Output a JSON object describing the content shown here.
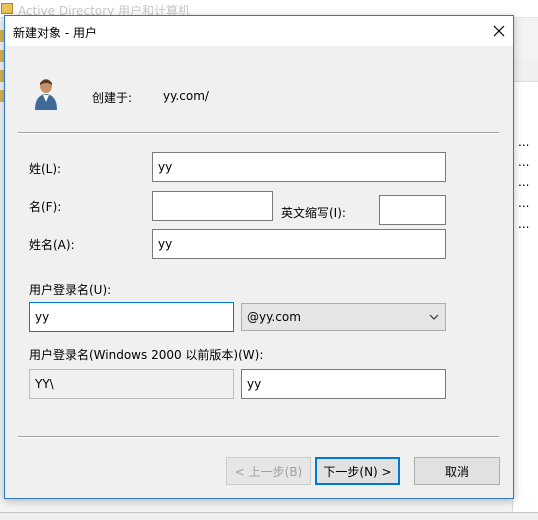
{
  "background_window": {
    "title": "Active Directory 用户和计算机",
    "list_ellipsis": [
      "...",
      "...",
      "...",
      "...",
      "..."
    ]
  },
  "dialog": {
    "title": "新建对象 - 用户",
    "created_in_label": "创建于:",
    "created_in_value": "yy.com/",
    "fields": {
      "last_name_label": "姓(L):",
      "last_name_value": "yy",
      "first_name_label": "名(F):",
      "first_name_value": "",
      "initials_label": "英文缩写(I):",
      "initials_value": "",
      "full_name_label": "姓名(A):",
      "full_name_value": "yy",
      "logon_name_label": "用户登录名(U):",
      "logon_name_value": "yy",
      "upn_suffix": "@yy.com",
      "pre2000_label": "用户登录名(Windows 2000 以前版本)(W):",
      "pre2000_domain": "YY\\",
      "pre2000_name": "yy"
    },
    "buttons": {
      "back": "< 上一步(B)",
      "next": "下一步(N) >",
      "cancel": "取消"
    }
  },
  "colors": {
    "accent": "#0078d7",
    "dialog_border": "#2b79c6",
    "dialog_bg": "#f0f0f0"
  },
  "icons": [
    "close-icon",
    "user-icon",
    "chevron-down-icon"
  ]
}
